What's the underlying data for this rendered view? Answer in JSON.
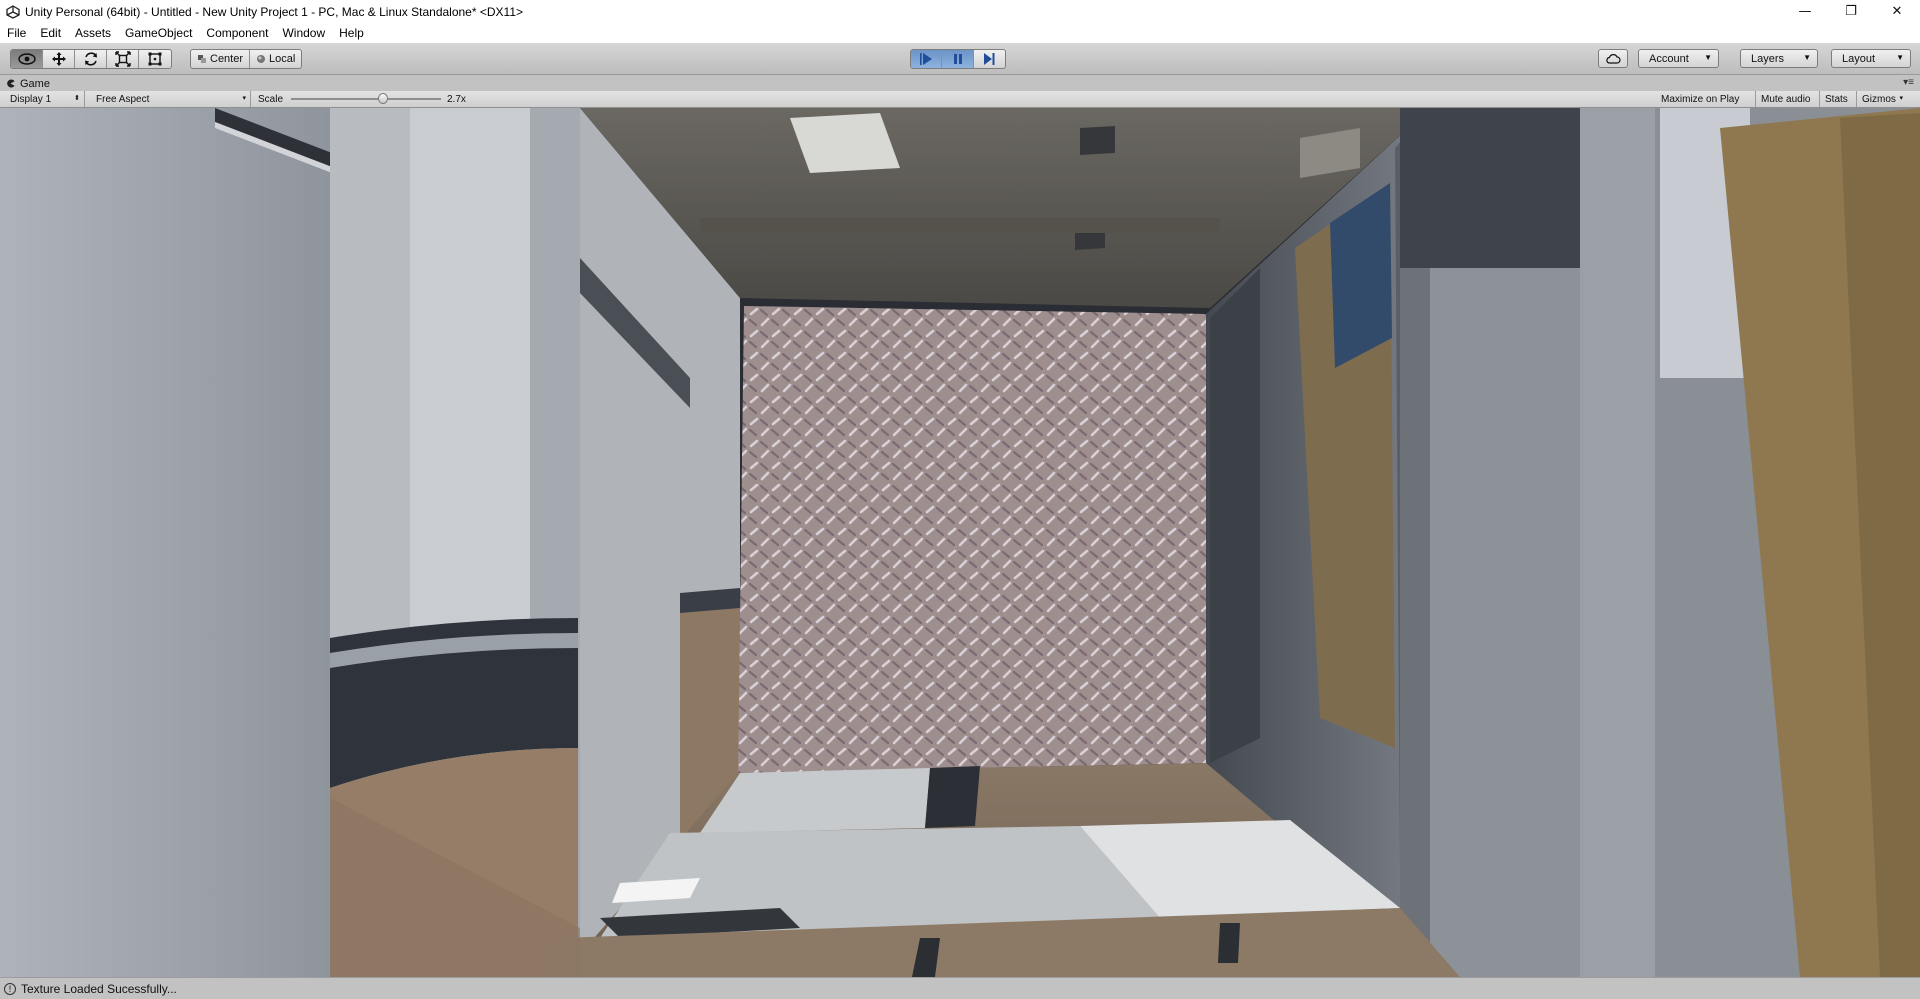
{
  "window": {
    "title": "Unity Personal (64bit) - Untitled - New Unity Project 1 - PC, Mac & Linux Standalone* <DX11>",
    "minimize_glyph": "—",
    "maximize_glyph": "❐",
    "close_glyph": "✕"
  },
  "menu": [
    "File",
    "Edit",
    "Assets",
    "GameObject",
    "Component",
    "Window",
    "Help"
  ],
  "toolbar": {
    "pivot_label": "Center",
    "space_label": "Local",
    "account_label": "Account",
    "layers_label": "Layers",
    "layout_label": "Layout"
  },
  "game_panel": {
    "tab_label": "Game",
    "display_label": "Display 1",
    "aspect_label": "Free Aspect",
    "scale_label": "Scale",
    "scale_value": "2.7x",
    "maximize_on_play": "Maximize on Play",
    "mute_audio": "Mute audio",
    "stats": "Stats",
    "gizmos": "Gizmos"
  },
  "status": {
    "message": "Texture Loaded Sucessfully..."
  },
  "icons": {
    "hand_tool": "eye-icon",
    "move_tool": "move-arrows-icon",
    "rotate_tool": "rotate-icon",
    "scale_tool": "scale-icon",
    "rect_tool": "rect-icon",
    "play": "play-icon",
    "pause": "pause-icon",
    "step": "step-icon",
    "cloud": "cloud-icon"
  },
  "colors": {
    "play_active": "#6c93c6",
    "toolbar_bg": "#c2c2c2"
  }
}
